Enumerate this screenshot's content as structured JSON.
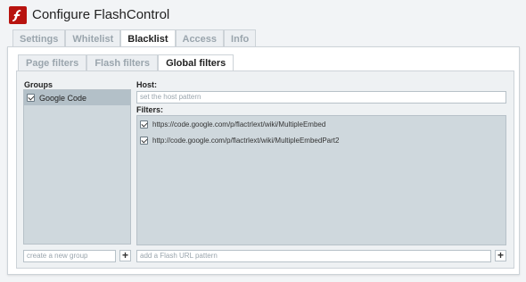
{
  "app": {
    "title": "Configure FlashControl",
    "logo_letter": "f"
  },
  "tabs": [
    {
      "label": "Settings"
    },
    {
      "label": "Whitelist"
    },
    {
      "label": "Blacklist"
    },
    {
      "label": "Access"
    },
    {
      "label": "Info"
    }
  ],
  "subtabs": [
    {
      "label": "Page filters"
    },
    {
      "label": "Flash filters"
    },
    {
      "label": "Global filters"
    }
  ],
  "groups": {
    "heading": "Groups",
    "items": [
      {
        "label": "Google Code",
        "checked": true
      }
    ],
    "new_group_placeholder": "create a new group",
    "add_symbol": "+"
  },
  "host": {
    "heading": "Host:",
    "placeholder": "set the host pattern"
  },
  "filters": {
    "heading": "Filters:",
    "items": [
      {
        "label": "https://code.google.com/p/flactrlext/wiki/MultipleEmbed",
        "checked": true
      },
      {
        "label": "http://code.google.com/p/flactrlext/wiki/MultipleEmbedPart2",
        "checked": true
      }
    ],
    "add_placeholder": "add a Flash URL pattern",
    "add_symbol": "+"
  },
  "colors": {
    "accent": "#b8130f"
  }
}
